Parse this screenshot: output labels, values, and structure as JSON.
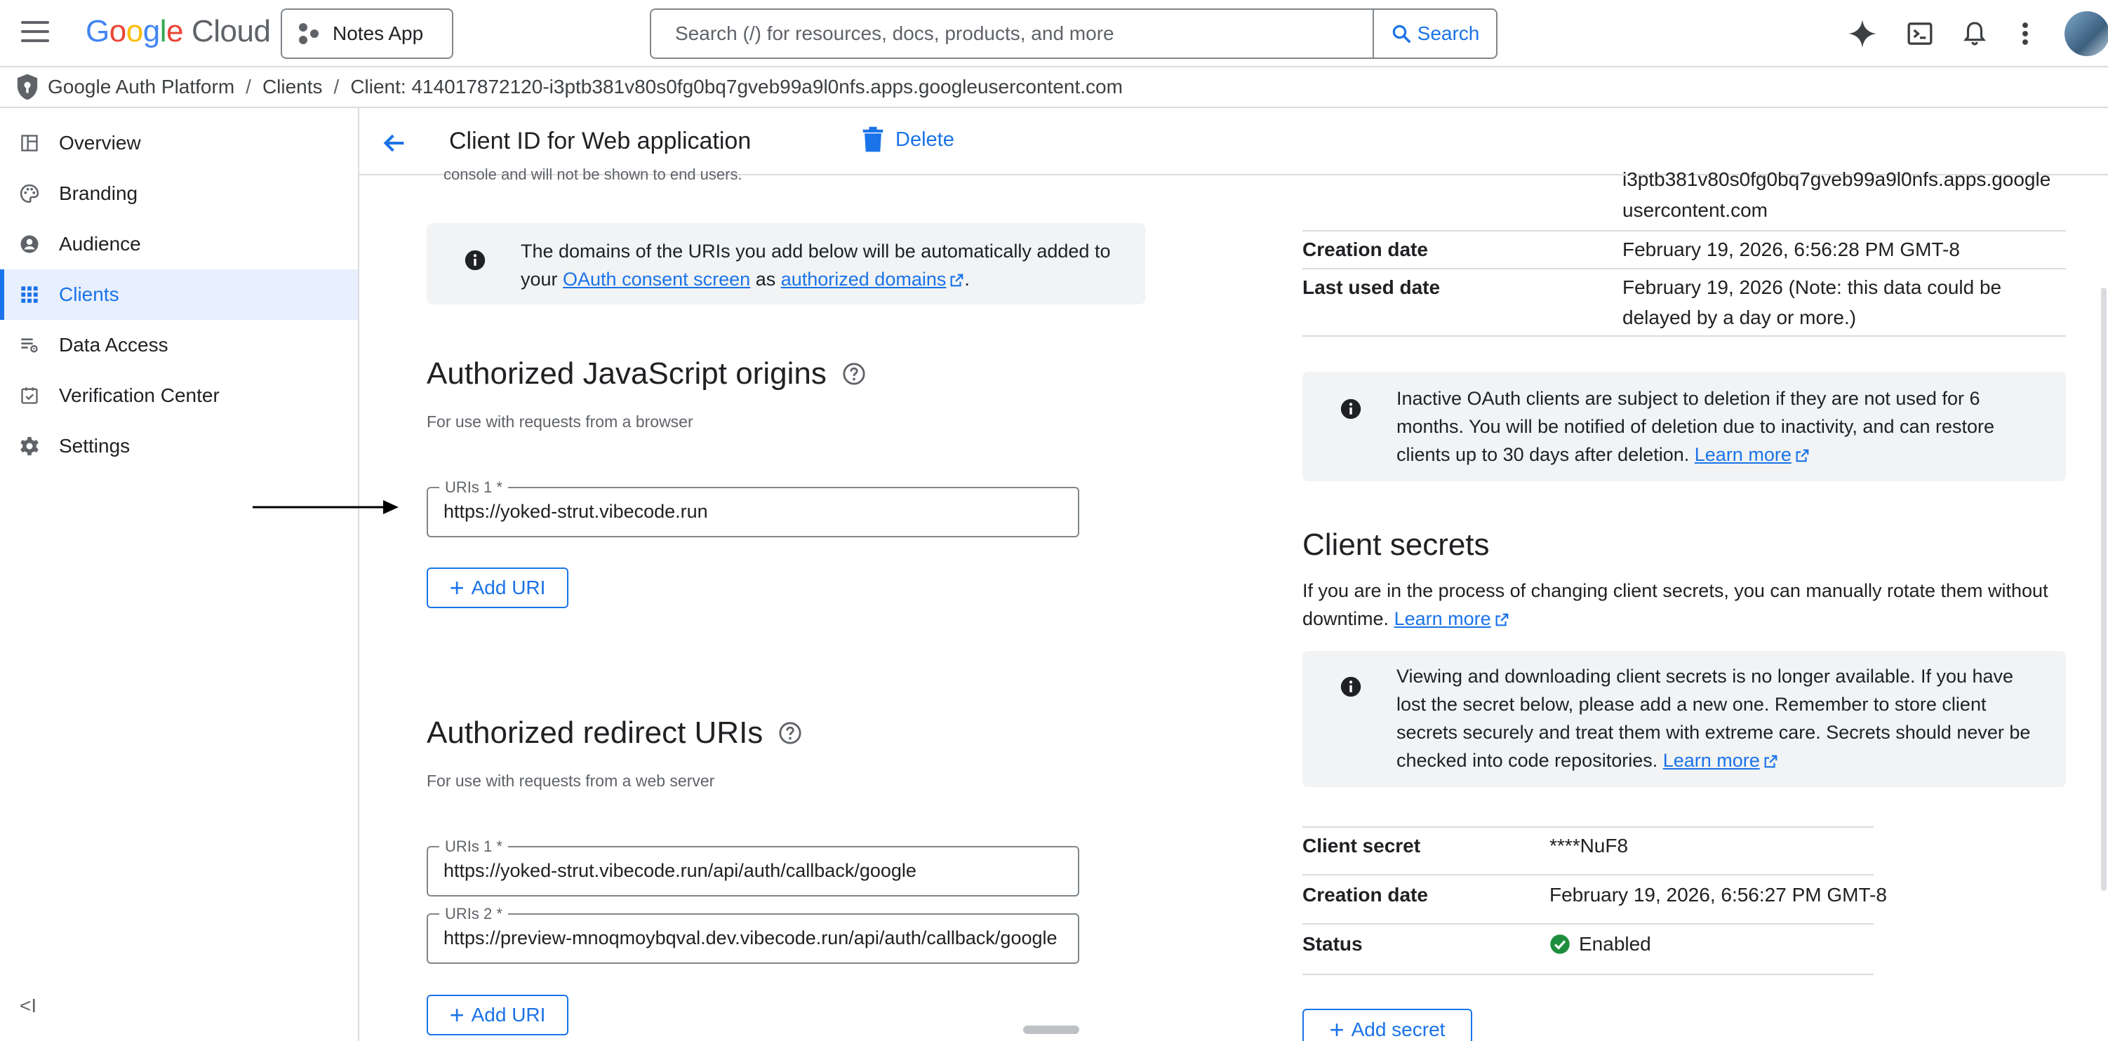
{
  "topbar": {
    "logo": {
      "g": "G",
      "o1": "o",
      "o2": "o",
      "g2": "g",
      "l": "l",
      "e": "e",
      "cloud": "Cloud"
    },
    "project_label": "Notes App",
    "search_placeholder": "Search (/) for resources, docs, products, and more",
    "search_button": "Search",
    "icons": [
      "gemini-sparkle-icon",
      "cloud-shell-icon",
      "notifications-icon",
      "more-vert-icon",
      "account-avatar"
    ]
  },
  "breadcrumb": {
    "items": [
      "Google Auth Platform",
      "Clients",
      "Client: 414017872120-i3ptb381v80s0fg0bq7gveb99a9l0nfs.apps.googleusercontent.com"
    ],
    "separator": "/"
  },
  "sidebar": {
    "items": [
      {
        "label": "Overview",
        "icon": "dashboard-icon",
        "active": false
      },
      {
        "label": "Branding",
        "icon": "palette-icon",
        "active": false
      },
      {
        "label": "Audience",
        "icon": "person-icon",
        "active": false
      },
      {
        "label": "Clients",
        "icon": "apps-grid-icon",
        "active": true
      },
      {
        "label": "Data Access",
        "icon": "data-access-icon",
        "active": false
      },
      {
        "label": "Verification Center",
        "icon": "verified-icon",
        "active": false
      },
      {
        "label": "Settings",
        "icon": "settings-icon",
        "active": false
      }
    ],
    "collapse_label": "<I"
  },
  "header": {
    "title": "Client ID for Web application",
    "delete_label": "Delete"
  },
  "left": {
    "fragment": "console and will not be shown to end users.",
    "note": {
      "text_before": "The domains of the URIs you add below will be automatically added to your ",
      "link1": "OAuth consent screen",
      "text_mid": " as ",
      "link2": "authorized domains",
      "text_after": "."
    },
    "js_origins": {
      "title": "Authorized JavaScript origins",
      "subtitle": "For use with requests from a browser",
      "fields": [
        {
          "label": "URIs 1 *",
          "value": "https://yoked-strut.vibecode.run"
        }
      ],
      "add_label": "Add URI"
    },
    "redirect_uris": {
      "title": "Authorized redirect URIs",
      "subtitle": "For use with requests from a web server",
      "fields": [
        {
          "label": "URIs 1 *",
          "value": "https://yoked-strut.vibecode.run/api/auth/callback/google"
        },
        {
          "label": "URIs 2 *",
          "value": "https://preview-mnoqmoybqval.dev.vibecode.run/api/auth/callback/google"
        }
      ],
      "add_label": "Add URI"
    }
  },
  "right": {
    "client_id_fragment_1": "i3ptb381v80s0fg0bq7gveb99a9l0nfs.apps.google",
    "client_id_fragment_2": "usercontent.com",
    "info_rows": [
      {
        "key": "Creation date",
        "value": "February 19, 2026, 6:56:28 PM GMT-8"
      },
      {
        "key": "Last used date",
        "value_line1": "February 19, 2026 (Note: this data could be",
        "value_line2": "delayed by a day or more.)"
      }
    ],
    "inactive_note": {
      "text": "Inactive OAuth clients are subject to deletion if they are not used for 6 months. You will be notified of deletion due to inactivity, and can restore clients up to 30 days after deletion. ",
      "link": "Learn more"
    },
    "client_secrets": {
      "title": "Client secrets",
      "desc": "If you are in the process of changing client secrets, you can manually rotate them without downtime. ",
      "desc_link": "Learn more",
      "note_text": "Viewing and downloading client secrets is no longer available. If you have lost the secret below, please add a new one. Remember to store client secrets securely and treat them with extreme care. Secrets should never be checked into code repositories. ",
      "note_link": "Learn more",
      "rows": [
        {
          "key": "Client secret",
          "value": "****NuF8"
        },
        {
          "key": "Creation date",
          "value": "February 19, 2026, 6:56:27 PM GMT-8"
        },
        {
          "key": "Status",
          "value": "Enabled"
        }
      ],
      "add_label": "Add secret"
    }
  },
  "colors": {
    "accent": "#1a73e8",
    "active_bg": "#e8f0fe",
    "note_bg": "#f1f3f4",
    "success": "#1e8e3e"
  }
}
